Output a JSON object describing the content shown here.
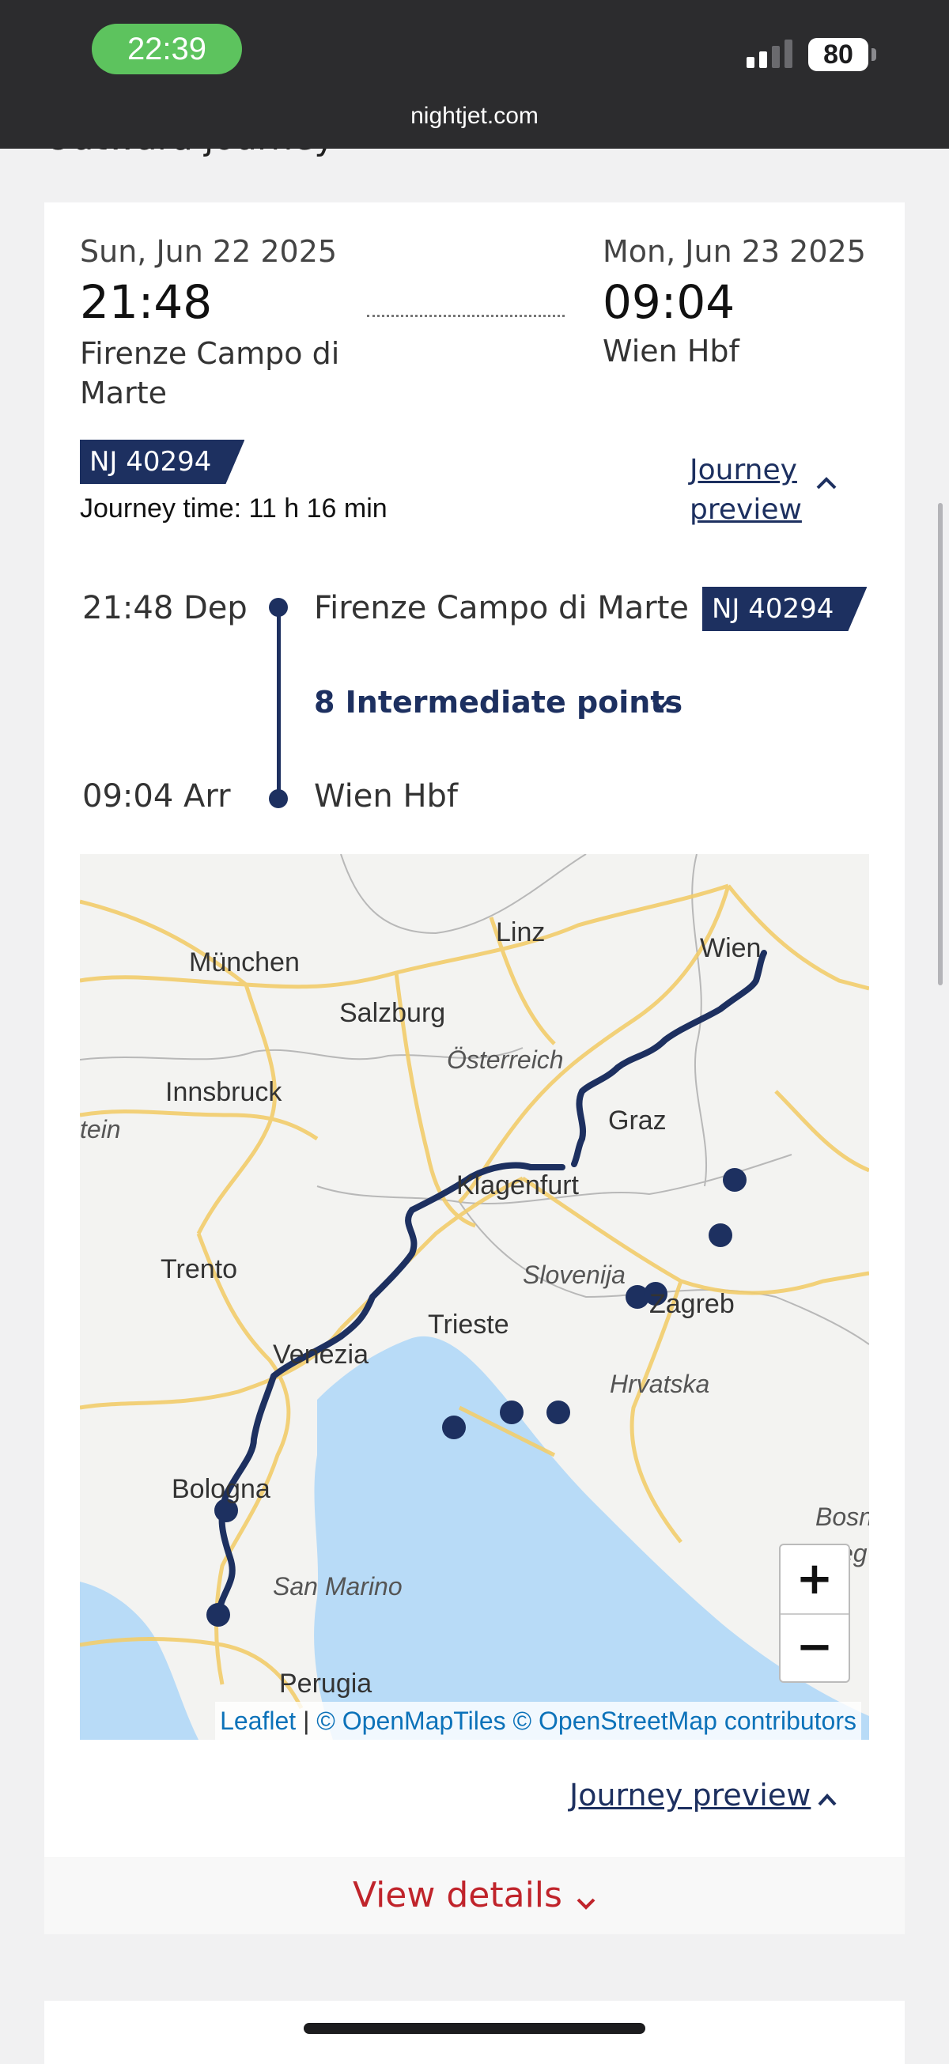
{
  "status_bar": {
    "time": "22:39",
    "battery": "80",
    "url": "nightjet.com"
  },
  "section": {
    "title": "Outward journey"
  },
  "journey": {
    "departure": {
      "date": "Sun, Jun 22 2025",
      "time": "21:48",
      "station": "Firenze Campo di Marte"
    },
    "arrival": {
      "date": "Mon, Jun 23 2025",
      "time": "09:04",
      "station": "Wien Hbf"
    },
    "train": "NJ 40294",
    "journey_time": "Journey time: 11 h 16 min",
    "preview_link": "Journey preview"
  },
  "timeline": {
    "dep_time": "21:48 Dep",
    "dep_station": "Firenze Campo di Marte",
    "train": "NJ 40294",
    "intermediate": "8 Intermediate points",
    "arr_time": "09:04 Arr",
    "arr_station": "Wien Hbf"
  },
  "map": {
    "labels": {
      "linz": "Linz",
      "wien": "Wien",
      "muenchen": "München",
      "salzburg": "Salzburg",
      "oesterreich": "Österreich",
      "innsbruck": "Innsbruck",
      "tein": "tein",
      "graz": "Graz",
      "klagenfurt": "Klagenfurt",
      "trento": "Trento",
      "slovenija": "Slovenija",
      "zagreb": "Zagreb",
      "trieste": "Trieste",
      "venezia": "Venezia",
      "hrvatska": "Hrvatska",
      "bologna": "Bologna",
      "bosna": "Bosn",
      "eg": "eg",
      "san_marino": "San Marino",
      "perugia": "Perugia"
    },
    "zoom_in": "+",
    "zoom_out": "−",
    "attribution": {
      "leaflet": "Leaflet",
      "sep": " | ",
      "openmaptiles": "© OpenMapTiles",
      "osm": "© OpenStreetMap contributors"
    },
    "colors": {
      "route": "#1d3060",
      "sea": "#b8dbf7",
      "road": "#f2cd6b",
      "land": "#f2f2f0"
    }
  },
  "footer": {
    "preview_link": "Journey preview",
    "view_details": "View details"
  }
}
